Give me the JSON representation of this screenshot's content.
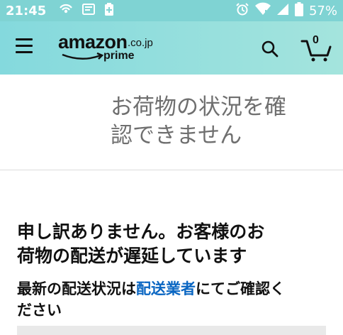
{
  "status_bar": {
    "time": "21:45",
    "battery_percent": "57%",
    "left_icons": [
      "hotspot-icon",
      "screencast-icon",
      "battery-saver-icon"
    ],
    "right_icons": [
      "alarm-icon",
      "wifi-icon",
      "signal-icon",
      "battery-icon"
    ]
  },
  "header": {
    "logo": {
      "brand": "amazon",
      "domain": ".co.jp",
      "tier": "prime"
    },
    "cart_count": "0",
    "colors": {
      "gradient_start": "#84d9dd",
      "gradient_end": "#a4e4dd"
    }
  },
  "title": {
    "line1": "お荷物の状況を確",
    "line2": "認できません"
  },
  "message": {
    "heading_line1": "申し訳ありません。お客様のお",
    "heading_line2": "荷物の配送が遅延しています",
    "sub_before": "最新の配送状況は",
    "sub_link": "配送業者",
    "sub_after": "にてご確認く",
    "sub_line2": "ださい"
  },
  "colors": {
    "link": "#0a66c2",
    "title_text": "#6f6f6f",
    "body_text": "#111111"
  }
}
